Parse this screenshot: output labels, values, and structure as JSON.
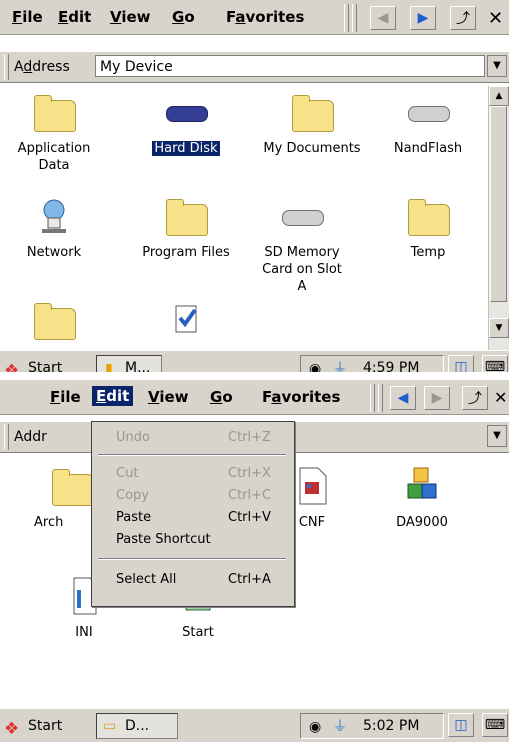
{
  "menus": {
    "file": "ile",
    "file_key": "F",
    "edit": "dit",
    "edit_key": "E",
    "view": "iew",
    "view_key": "V",
    "go": "o",
    "go_key": "G",
    "favorites_a": "F",
    "favorites_key": "a",
    "favorites_b": "vorites"
  },
  "address": {
    "label_a": "A",
    "label_key": "d",
    "label_b": "dress",
    "value": "My Device",
    "label_short": "Addr"
  },
  "icons_top": [
    {
      "label": "Application Data"
    },
    {
      "label": "Hard Disk"
    },
    {
      "label": "My Documents"
    },
    {
      "label": "NandFlash"
    },
    {
      "label": "Network"
    },
    {
      "label": "Program Files"
    },
    {
      "label": "SD Memory Card on Slot A"
    },
    {
      "label": "Temp"
    }
  ],
  "taskbar_top": {
    "start": "Start",
    "item": "M...",
    "time": "4:59 PM"
  },
  "edit_menu": {
    "undo": "Undo",
    "undo_sc": "Ctrl+Z",
    "cut": "Cut",
    "cut_sc": "Ctrl+X",
    "copy": "Copy",
    "copy_sc": "Ctrl+C",
    "paste": "Paste",
    "paste_sc": "Ctrl+V",
    "paste_shortcut": "Paste Shortcut",
    "select_all": "Select All",
    "select_all_sc": "Ctrl+A"
  },
  "icons_bottom": [
    {
      "label": "Arch"
    },
    {
      "label": "CNF"
    },
    {
      "label": "DA9000"
    },
    {
      "label": "INI"
    },
    {
      "label": "Start"
    }
  ],
  "taskbar_bottom": {
    "start": "Start",
    "item": "D...",
    "time": "5:02 PM"
  },
  "colors": {
    "highlight": "#0a246a",
    "chrome": "#d8d4cc"
  }
}
